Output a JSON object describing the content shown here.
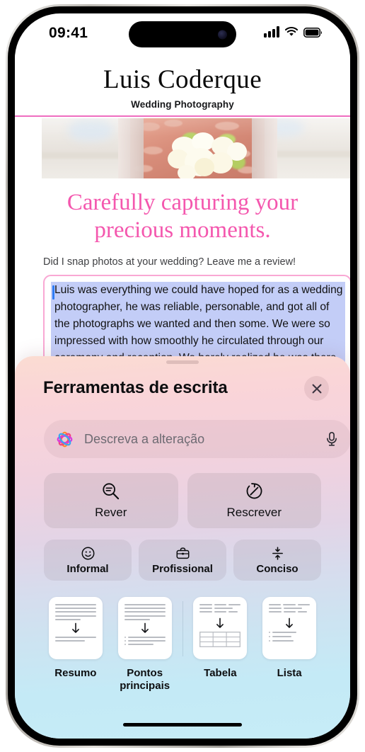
{
  "status_bar": {
    "time": "09:41",
    "cellular_icon": "signal-bars-icon",
    "wifi_icon": "wifi-icon",
    "battery_icon": "battery-full-icon"
  },
  "site": {
    "brand_title": "Luis Coderque",
    "brand_subtitle": "Wedding Photography",
    "accent_pink": "#ef6ec0",
    "headline": "Carefully capturing your precious moments.",
    "headline_color": "#f457ae",
    "review_prompt": "Did I snap photos at your wedding? Leave me a review!",
    "hero_photo_alt": "bride-holding-white-bouquet-photo"
  },
  "review_field": {
    "value": "Luis was everything we could have hoped for as a wedding photographer, he was reliable, personable, and got all of the photographs we wanted and then some. We were so impressed with how smoothly he circulated through our ceremony and reception. We barely realized he was there except when he was very",
    "border_color": "#f9a8d4",
    "selection_color": "#c3cdf7",
    "caret_color": "#2f7df6"
  },
  "writing_tools": {
    "title": "Ferramentas de escrita",
    "close_icon": "close-icon",
    "grabber_icon": "drag-handle-icon",
    "describe": {
      "placeholder": "Descreva a alteração",
      "leading_icon": "apple-intelligence-icon",
      "mic_icon": "mic-icon"
    },
    "primary_actions": [
      {
        "label": "Rever",
        "icon": "proofread-magnifier-icon"
      },
      {
        "label": "Rescrever",
        "icon": "rewrite-circular-arrow-icon"
      }
    ],
    "tone_actions": [
      {
        "label": "Informal",
        "icon": "smiley-face-icon"
      },
      {
        "label": "Profissional",
        "icon": "briefcase-icon"
      },
      {
        "label": "Conciso",
        "icon": "compress-arrows-icon"
      }
    ],
    "format_cards": [
      {
        "label": "Resumo",
        "icon": "summary-document-icon"
      },
      {
        "label": "Pontos principais",
        "icon": "key-points-document-icon"
      },
      {
        "label": "Tabela",
        "icon": "table-document-icon"
      },
      {
        "label": "Lista",
        "icon": "list-document-icon"
      }
    ]
  },
  "home_indicator": "home-indicator"
}
